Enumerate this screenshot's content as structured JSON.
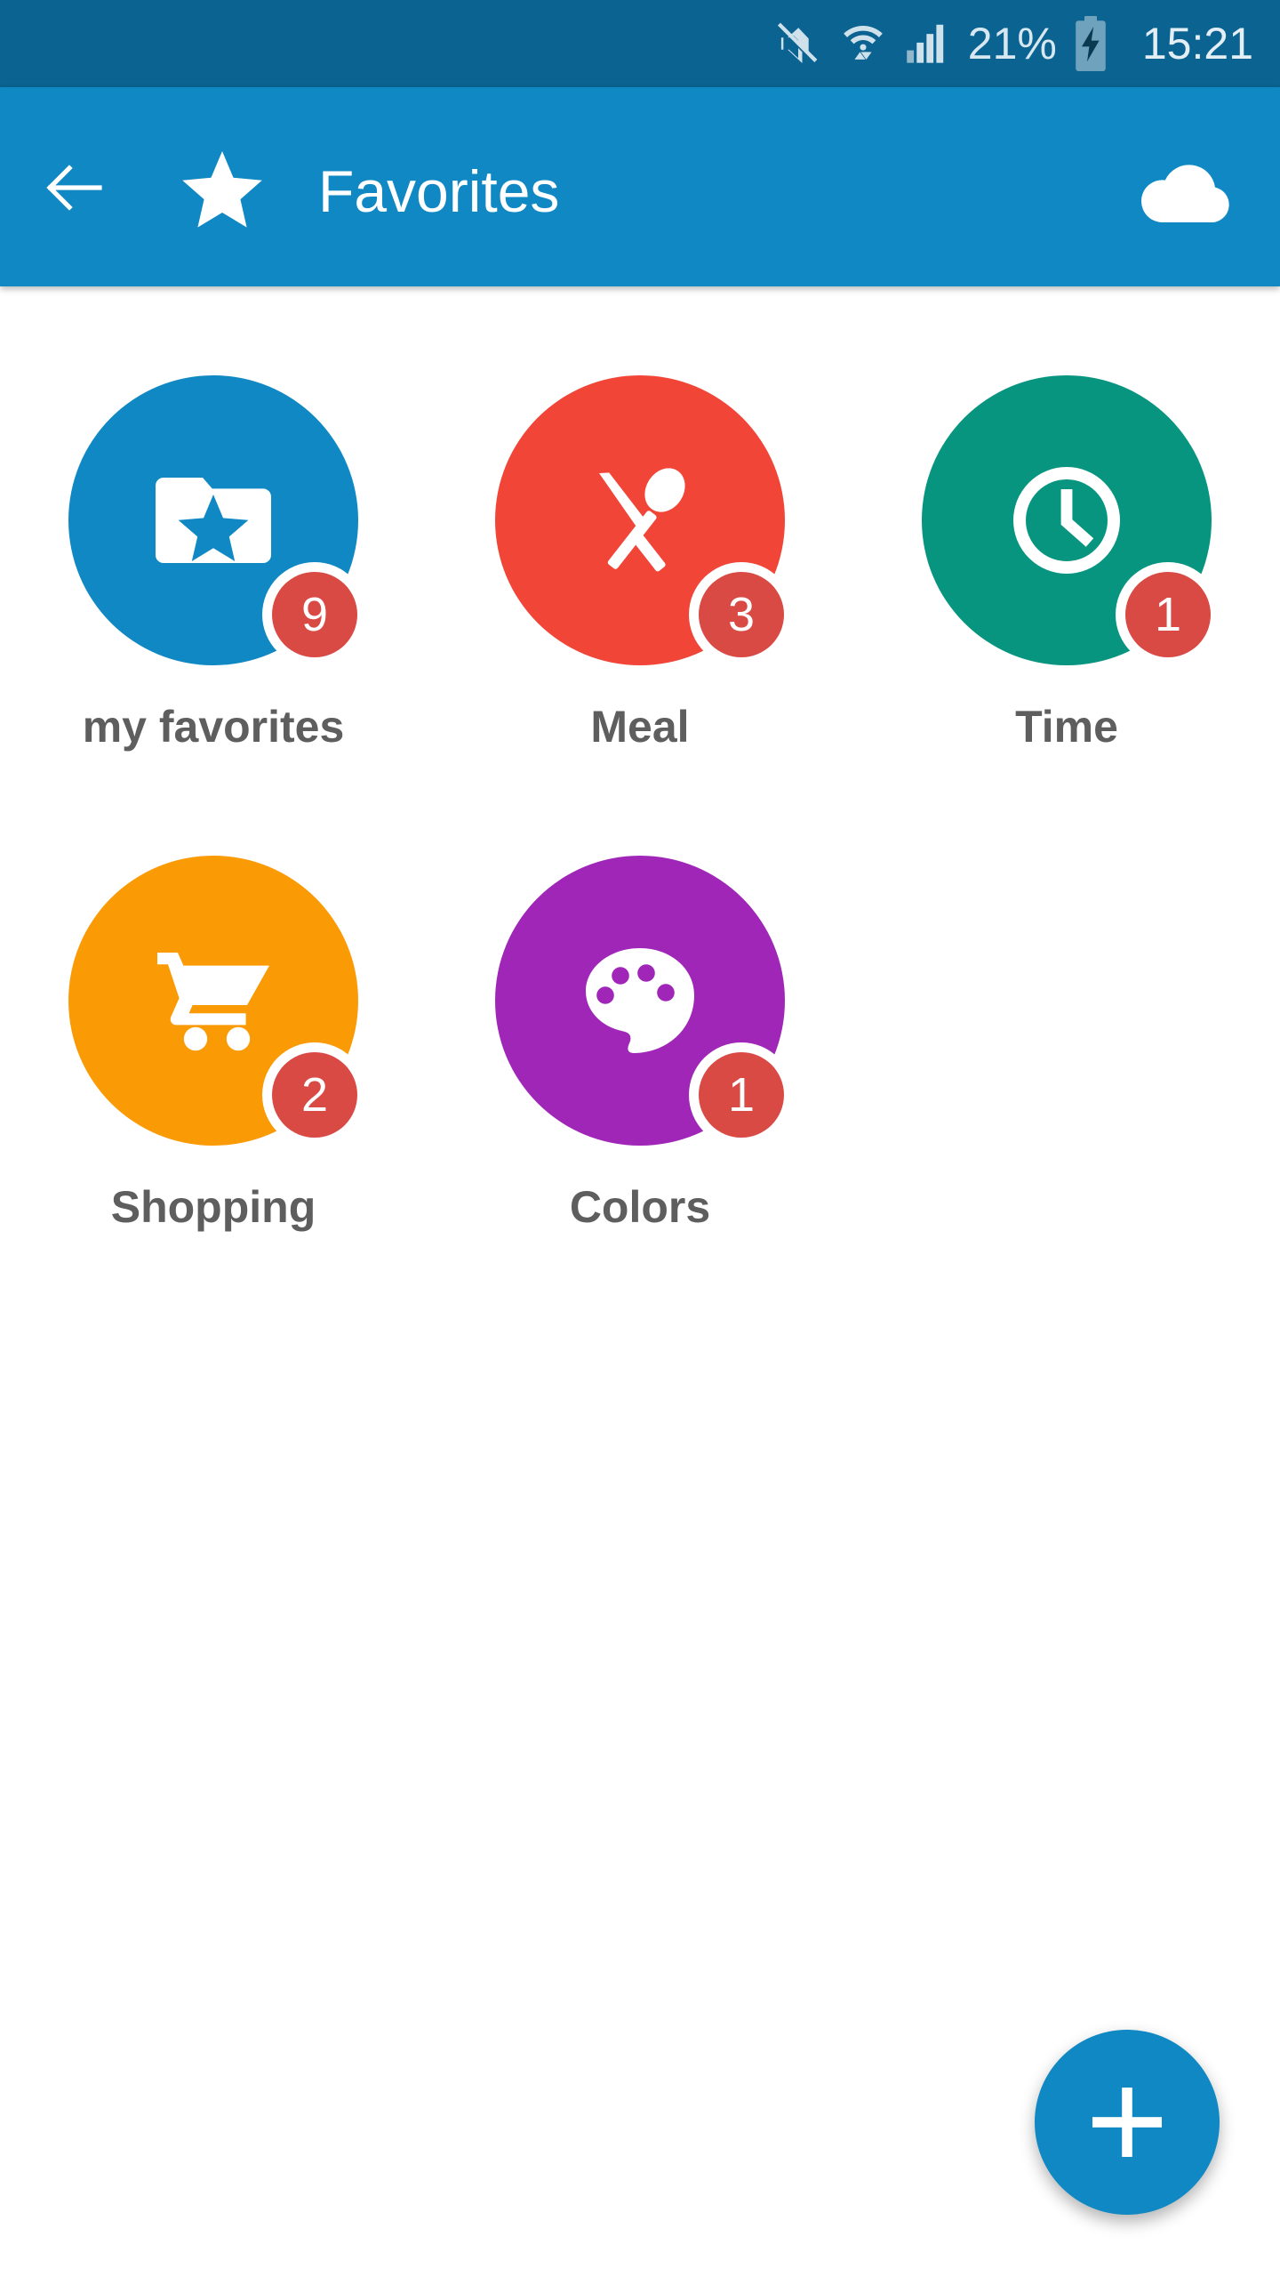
{
  "status_bar": {
    "background": "#0a6390",
    "battery_percent": "21%",
    "clock": "15:21",
    "icons": [
      "mute-icon",
      "wifi-icon",
      "signal-icon",
      "battery-charging-icon"
    ]
  },
  "app_bar": {
    "background": "#1088c4",
    "title": "Favorites",
    "back_icon": "back-arrow-icon",
    "title_icon": "star-icon",
    "action_icon": "cloud-download-icon"
  },
  "categories": [
    {
      "label": "my favorites",
      "badge": "9",
      "color": "#1088c4",
      "icon": "folder-star-icon"
    },
    {
      "label": "Meal",
      "badge": "3",
      "color": "#f04537",
      "icon": "cutlery-icon"
    },
    {
      "label": "Time",
      "badge": "1",
      "color": "#07957f",
      "icon": "clock-icon"
    },
    {
      "label": "Shopping",
      "badge": "2",
      "color": "#fa9a05",
      "icon": "shopping-cart-icon"
    },
    {
      "label": "Colors",
      "badge": "1",
      "color": "#a026b8",
      "icon": "palette-icon"
    }
  ],
  "badge_color": "#d94a45",
  "label_color": "#5e5e5e",
  "fab": {
    "icon": "plus-icon",
    "color": "#1088c4"
  }
}
